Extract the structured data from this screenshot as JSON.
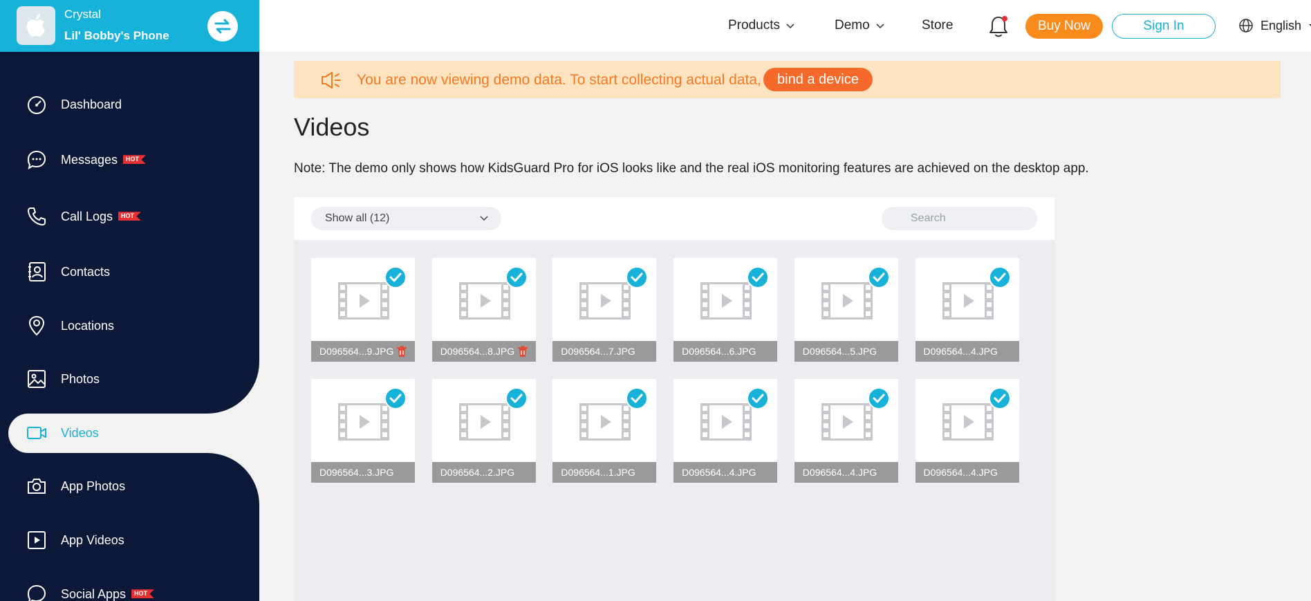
{
  "device": {
    "owner": "Crystal",
    "name": "Lil' Bobby's Phone"
  },
  "nav": {
    "items": [
      {
        "label": "Dashboard",
        "icon": "dashboard-icon",
        "hot": ""
      },
      {
        "label": "Messages",
        "icon": "messages-icon",
        "hot": "HOT"
      },
      {
        "label": "Call Logs",
        "icon": "phone-icon",
        "hot": "HOT"
      },
      {
        "label": "Contacts",
        "icon": "contacts-icon",
        "hot": ""
      },
      {
        "label": "Locations",
        "icon": "location-pin-icon",
        "hot": ""
      },
      {
        "label": "Photos",
        "icon": "photo-icon",
        "hot": ""
      },
      {
        "label": "Videos",
        "icon": "video-camera-icon",
        "hot": "",
        "active": true
      },
      {
        "label": "App Photos",
        "icon": "camera-icon",
        "hot": ""
      },
      {
        "label": "App Videos",
        "icon": "play-square-icon",
        "hot": ""
      },
      {
        "label": "Social Apps",
        "icon": "chat-icon",
        "hot": "HOT"
      }
    ]
  },
  "topbar": {
    "products": "Products",
    "demo": "Demo",
    "store": "Store",
    "buy_now": "Buy Now",
    "sign_in": "Sign In",
    "language": "English"
  },
  "banner": {
    "text": "You are now viewing demo data. To start collecting actual data,",
    "button": "bind a device"
  },
  "page": {
    "title": "Videos",
    "note": "Note: The demo only shows how KidsGuard Pro for iOS looks like and the real iOS monitoring features are achieved on the desktop app."
  },
  "toolbar": {
    "filter": "Show all (12)",
    "search_placeholder": "Search"
  },
  "videos": [
    {
      "name": "D096564...9.JPG",
      "deletable": true
    },
    {
      "name": "D096564...8.JPG",
      "deletable": true
    },
    {
      "name": "D096564...7.JPG",
      "deletable": false
    },
    {
      "name": "D096564...6.JPG",
      "deletable": false
    },
    {
      "name": "D096564...5.JPG",
      "deletable": false
    },
    {
      "name": "D096564...4.JPG",
      "deletable": false
    },
    {
      "name": "D096564...3.JPG",
      "deletable": false
    },
    {
      "name": "D096564...2.JPG",
      "deletable": false
    },
    {
      "name": "D096564...1.JPG",
      "deletable": false
    },
    {
      "name": "D096564...4.JPG",
      "deletable": false
    },
    {
      "name": "D096564...4.JPG",
      "deletable": false
    },
    {
      "name": "D096564...4.JPG",
      "deletable": false
    }
  ],
  "colors": {
    "accent": "#17b2da",
    "sidebar": "#0c1837",
    "buy_now": "#fb8a1c",
    "banner_text": "#f27a25",
    "hot_badge": "#e53131"
  }
}
